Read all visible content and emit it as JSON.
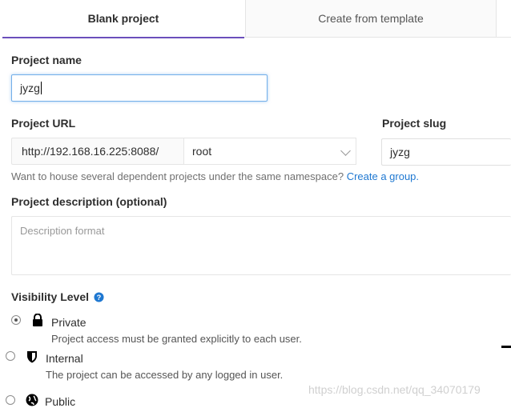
{
  "tabs": [
    {
      "label": "Blank project",
      "active": true
    },
    {
      "label": "Create from template",
      "active": false
    }
  ],
  "project_name": {
    "label": "Project name",
    "value": "jyzg"
  },
  "project_url": {
    "label": "Project URL",
    "prefix": "http://192.168.16.225:8088/",
    "namespace": "root"
  },
  "project_slug": {
    "label": "Project slug",
    "value": "jyzg"
  },
  "namespace_help": {
    "text": "Want to house several dependent projects under the same namespace?",
    "link": "Create a group."
  },
  "description": {
    "label": "Project description (optional)",
    "placeholder": "Description format"
  },
  "visibility": {
    "label": "Visibility Level",
    "help_icon": "question-circle-icon",
    "options": [
      {
        "label": "Private",
        "desc": "Project access must be granted explicitly to each user.",
        "icon": "lock-icon",
        "checked": true
      },
      {
        "label": "Internal",
        "desc": "The project can be accessed by any logged in user.",
        "icon": "shield-icon",
        "checked": false
      },
      {
        "label": "Public",
        "icon": "globe-icon",
        "checked": false
      }
    ]
  },
  "watermark": "https://blog.csdn.net/qq_34070179",
  "colors": {
    "accent": "#6b4fbb",
    "link": "#1f78d1",
    "focus": "#73afea"
  }
}
